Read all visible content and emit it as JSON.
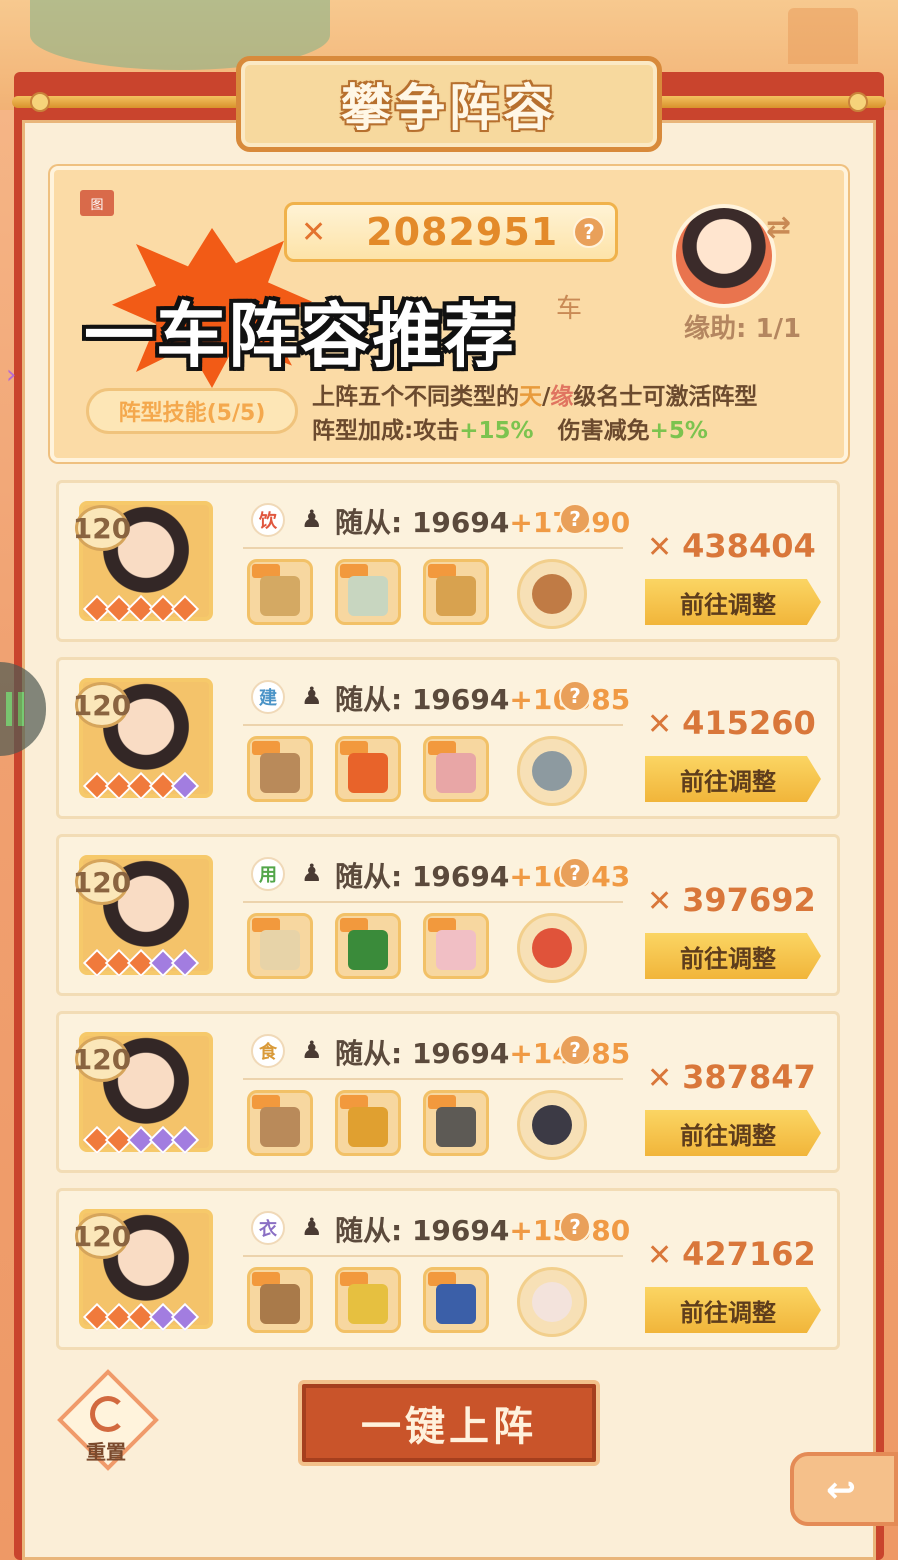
{
  "title": "攀争阵容",
  "badge_icon": "图",
  "total_power": "2082951",
  "promo_text": "一车阵容推荐",
  "ghost_text": "车",
  "helper_label": "缘助: 1/1",
  "skill_tag": "阵型技能(5/5)",
  "skill_desc": {
    "line1_a": "上阵五个不同类型的",
    "sky": "天",
    "slash": "/",
    "fate": "缘",
    "line1_b": "级名士可激活阵型",
    "line2_a": "阵型加成:攻击",
    "attack_bonus": "+15%",
    "line2_b": "伤害减免",
    "reduce_bonus": "+5%"
  },
  "help_glyph": "?",
  "follow_label": "随从:",
  "adjust_label": "前往调整",
  "heroes": [
    {
      "level": "120",
      "category": "饮",
      "category_color": "#e0573f",
      "follow_base": "19694",
      "follow_bonus": "+17190",
      "power": "438404",
      "items": [
        "#d4a963",
        "#c8d6c0",
        "#d8a24f"
      ],
      "pet": "#c07b45",
      "stars": [
        "o",
        "o",
        "o",
        "o",
        "o"
      ]
    },
    {
      "level": "120",
      "category": "建",
      "category_color": "#4a93c7",
      "follow_base": "19694",
      "follow_bonus": "+16385",
      "power": "415260",
      "items": [
        "#b98a5a",
        "#e8632a",
        "#e8a6a6"
      ],
      "pet": "#8d9aa0",
      "stars": [
        "o",
        "o",
        "o",
        "o",
        "p"
      ]
    },
    {
      "level": "120",
      "category": "用",
      "category_color": "#53a64a",
      "follow_base": "19694",
      "follow_bonus": "+16043",
      "power": "397692",
      "items": [
        "#e7d3a8",
        "#3a8b3a",
        "#f1bfc5"
      ],
      "pet": "#e0533a",
      "stars": [
        "o",
        "o",
        "o",
        "p",
        "p"
      ]
    },
    {
      "level": "120",
      "category": "食",
      "category_color": "#d99a3a",
      "follow_base": "19694",
      "follow_bonus": "+14885",
      "power": "387847",
      "items": [
        "#b98a5a",
        "#e0a030",
        "#5d5a55"
      ],
      "pet": "#3c3a45",
      "stars": [
        "o",
        "o",
        "p",
        "p",
        "p"
      ]
    },
    {
      "level": "120",
      "category": "衣",
      "category_color": "#8a6fc4",
      "follow_base": "19694",
      "follow_bonus": "+15080",
      "power": "427162",
      "items": [
        "#a97a4a",
        "#e6c040",
        "#3b5fa8"
      ],
      "pet": "#f3e3dc",
      "stars": [
        "o",
        "o",
        "o",
        "p",
        "p"
      ]
    }
  ],
  "reset_label": "重置",
  "deploy_label": "一键上阵"
}
